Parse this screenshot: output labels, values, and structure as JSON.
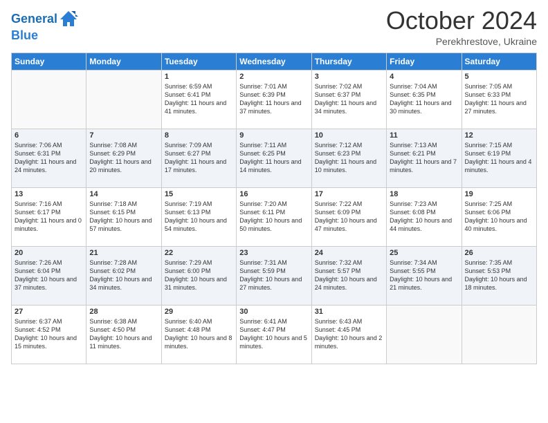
{
  "logo": {
    "line1": "General",
    "line2": "Blue"
  },
  "title": "October 2024",
  "location": "Perekhrestove, Ukraine",
  "days_of_week": [
    "Sunday",
    "Monday",
    "Tuesday",
    "Wednesday",
    "Thursday",
    "Friday",
    "Saturday"
  ],
  "weeks": [
    [
      {
        "day": "",
        "content": ""
      },
      {
        "day": "",
        "content": ""
      },
      {
        "day": "1",
        "content": "Sunrise: 6:59 AM\nSunset: 6:41 PM\nDaylight: 11 hours and 41 minutes."
      },
      {
        "day": "2",
        "content": "Sunrise: 7:01 AM\nSunset: 6:39 PM\nDaylight: 11 hours and 37 minutes."
      },
      {
        "day": "3",
        "content": "Sunrise: 7:02 AM\nSunset: 6:37 PM\nDaylight: 11 hours and 34 minutes."
      },
      {
        "day": "4",
        "content": "Sunrise: 7:04 AM\nSunset: 6:35 PM\nDaylight: 11 hours and 30 minutes."
      },
      {
        "day": "5",
        "content": "Sunrise: 7:05 AM\nSunset: 6:33 PM\nDaylight: 11 hours and 27 minutes."
      }
    ],
    [
      {
        "day": "6",
        "content": "Sunrise: 7:06 AM\nSunset: 6:31 PM\nDaylight: 11 hours and 24 minutes."
      },
      {
        "day": "7",
        "content": "Sunrise: 7:08 AM\nSunset: 6:29 PM\nDaylight: 11 hours and 20 minutes."
      },
      {
        "day": "8",
        "content": "Sunrise: 7:09 AM\nSunset: 6:27 PM\nDaylight: 11 hours and 17 minutes."
      },
      {
        "day": "9",
        "content": "Sunrise: 7:11 AM\nSunset: 6:25 PM\nDaylight: 11 hours and 14 minutes."
      },
      {
        "day": "10",
        "content": "Sunrise: 7:12 AM\nSunset: 6:23 PM\nDaylight: 11 hours and 10 minutes."
      },
      {
        "day": "11",
        "content": "Sunrise: 7:13 AM\nSunset: 6:21 PM\nDaylight: 11 hours and 7 minutes."
      },
      {
        "day": "12",
        "content": "Sunrise: 7:15 AM\nSunset: 6:19 PM\nDaylight: 11 hours and 4 minutes."
      }
    ],
    [
      {
        "day": "13",
        "content": "Sunrise: 7:16 AM\nSunset: 6:17 PM\nDaylight: 11 hours and 0 minutes."
      },
      {
        "day": "14",
        "content": "Sunrise: 7:18 AM\nSunset: 6:15 PM\nDaylight: 10 hours and 57 minutes."
      },
      {
        "day": "15",
        "content": "Sunrise: 7:19 AM\nSunset: 6:13 PM\nDaylight: 10 hours and 54 minutes."
      },
      {
        "day": "16",
        "content": "Sunrise: 7:20 AM\nSunset: 6:11 PM\nDaylight: 10 hours and 50 minutes."
      },
      {
        "day": "17",
        "content": "Sunrise: 7:22 AM\nSunset: 6:09 PM\nDaylight: 10 hours and 47 minutes."
      },
      {
        "day": "18",
        "content": "Sunrise: 7:23 AM\nSunset: 6:08 PM\nDaylight: 10 hours and 44 minutes."
      },
      {
        "day": "19",
        "content": "Sunrise: 7:25 AM\nSunset: 6:06 PM\nDaylight: 10 hours and 40 minutes."
      }
    ],
    [
      {
        "day": "20",
        "content": "Sunrise: 7:26 AM\nSunset: 6:04 PM\nDaylight: 10 hours and 37 minutes."
      },
      {
        "day": "21",
        "content": "Sunrise: 7:28 AM\nSunset: 6:02 PM\nDaylight: 10 hours and 34 minutes."
      },
      {
        "day": "22",
        "content": "Sunrise: 7:29 AM\nSunset: 6:00 PM\nDaylight: 10 hours and 31 minutes."
      },
      {
        "day": "23",
        "content": "Sunrise: 7:31 AM\nSunset: 5:59 PM\nDaylight: 10 hours and 27 minutes."
      },
      {
        "day": "24",
        "content": "Sunrise: 7:32 AM\nSunset: 5:57 PM\nDaylight: 10 hours and 24 minutes."
      },
      {
        "day": "25",
        "content": "Sunrise: 7:34 AM\nSunset: 5:55 PM\nDaylight: 10 hours and 21 minutes."
      },
      {
        "day": "26",
        "content": "Sunrise: 7:35 AM\nSunset: 5:53 PM\nDaylight: 10 hours and 18 minutes."
      }
    ],
    [
      {
        "day": "27",
        "content": "Sunrise: 6:37 AM\nSunset: 4:52 PM\nDaylight: 10 hours and 15 minutes."
      },
      {
        "day": "28",
        "content": "Sunrise: 6:38 AM\nSunset: 4:50 PM\nDaylight: 10 hours and 11 minutes."
      },
      {
        "day": "29",
        "content": "Sunrise: 6:40 AM\nSunset: 4:48 PM\nDaylight: 10 hours and 8 minutes."
      },
      {
        "day": "30",
        "content": "Sunrise: 6:41 AM\nSunset: 4:47 PM\nDaylight: 10 hours and 5 minutes."
      },
      {
        "day": "31",
        "content": "Sunrise: 6:43 AM\nSunset: 4:45 PM\nDaylight: 10 hours and 2 minutes."
      },
      {
        "day": "",
        "content": ""
      },
      {
        "day": "",
        "content": ""
      }
    ]
  ]
}
